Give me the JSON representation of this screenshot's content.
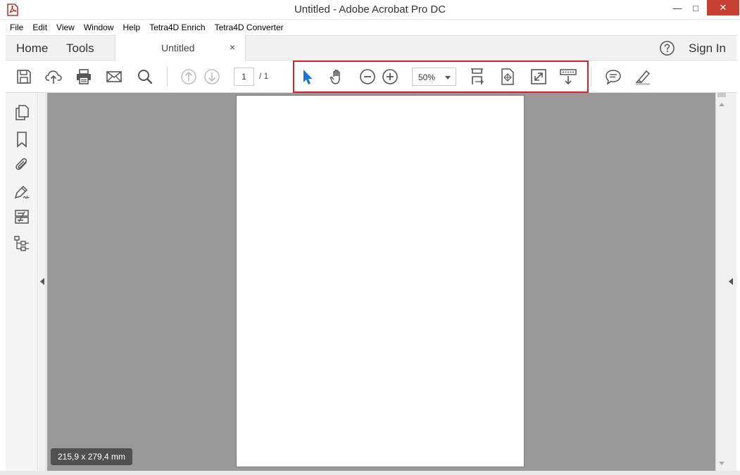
{
  "window": {
    "title": "Untitled - Adobe Acrobat Pro DC",
    "minimize": "—",
    "maximize": "□",
    "close": "✕"
  },
  "menubar": {
    "items": [
      "File",
      "Edit",
      "View",
      "Window",
      "Help",
      "Tetra4D Enrich",
      "Tetra4D Converter"
    ]
  },
  "tabbar": {
    "home": "Home",
    "tools": "Tools",
    "doc_tab": "Untitled",
    "doc_tab_close": "×",
    "sign_in": "Sign In"
  },
  "toolbar": {
    "page_current": "1",
    "page_total": "/ 1",
    "zoom": "50%",
    "icons": [
      "save-icon",
      "cloud-upload-icon",
      "print-icon",
      "email-icon",
      "search-icon",
      "previous-page-icon",
      "next-page-icon",
      "select-cursor-icon",
      "hand-icon",
      "zoom-out-icon",
      "zoom-in-icon",
      "scrolling-mode-icon",
      "fit-page-icon",
      "full-screen-icon",
      "read-mode-icon",
      "comment-icon",
      "highlight-icon"
    ]
  },
  "left_panel": {
    "icons": [
      "pages-icon",
      "bookmark-icon",
      "attachment-icon",
      "signature-icon",
      "compare-icon",
      "layers-icon"
    ]
  },
  "document": {
    "page_size": "215,9 x 279,4 mm"
  },
  "colors": {
    "highlight": "#d81f26",
    "select_tool": "#1473e6",
    "doc_background": "#999999"
  }
}
